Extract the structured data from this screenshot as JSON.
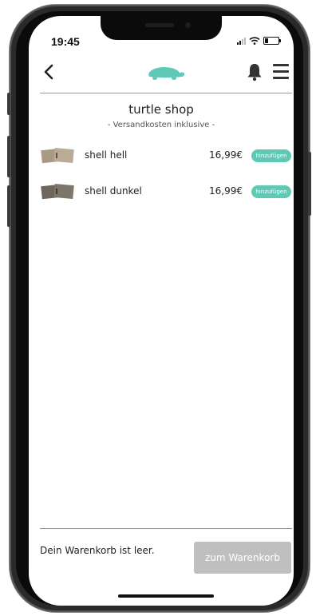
{
  "status_bar": {
    "time": "19:45",
    "signal_icon": "signal-icon",
    "wifi_icon": "wifi-icon",
    "battery_icon": "battery-icon"
  },
  "navbar": {
    "back_icon": "chevron-left-icon",
    "logo_icon": "turtle-logo-icon",
    "bell_icon": "bell-icon",
    "menu_icon": "hamburger-menu-icon"
  },
  "shop": {
    "title": "turtle shop",
    "subtitle": "- Versandkosten inklusive -"
  },
  "products": [
    {
      "name": "shell hell",
      "price": "16,99€",
      "add_label": "hinzufügen",
      "thumb_color": "#a89a86"
    },
    {
      "name": "shell dunkel",
      "price": "16,99€",
      "add_label": "hinzufügen",
      "thumb_color": "#6e665c"
    }
  ],
  "cart": {
    "status": "Dein Warenkorb ist leer.",
    "button_label": "zum Warenkorb"
  },
  "colors": {
    "accent": "#5fc9b5",
    "cart_button": "#bfbfbf",
    "text": "#222222"
  }
}
